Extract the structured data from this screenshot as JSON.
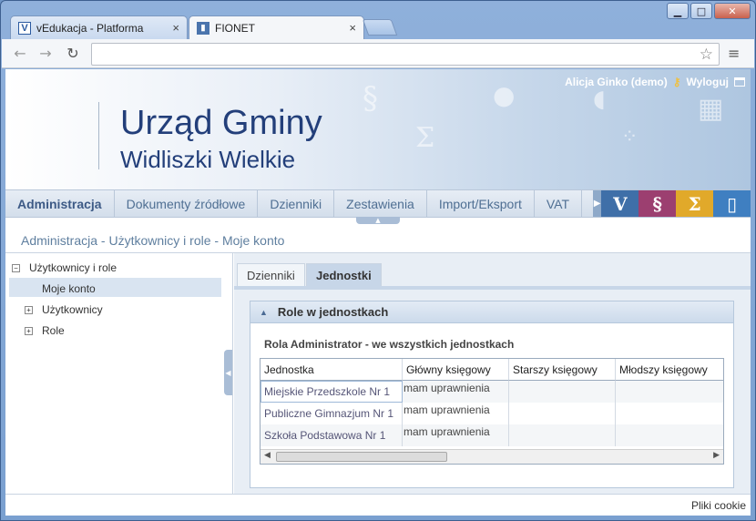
{
  "browser": {
    "tabs": [
      {
        "title": "vEdukacja - Platforma",
        "icon": "v-logo-icon"
      },
      {
        "title": "FIONET",
        "icon": "fionet-logo-icon"
      }
    ],
    "close_glyph": "×",
    "window_controls": {
      "minimize": "▁",
      "maximize": "□",
      "close": "✕"
    },
    "address": ""
  },
  "banner": {
    "title_line1": "Urząd Gminy",
    "title_line2": "Widliszki Wielkie",
    "user": "Alicja Ginko (demo)",
    "logout": "Wyloguj"
  },
  "nav": {
    "items": [
      "Administracja",
      "Dokumenty źródłowe",
      "Dzienniki",
      "Zestawienia",
      "Import/Eksport",
      "VAT"
    ],
    "active": "Administracja",
    "modules": [
      {
        "glyph": "V",
        "color": "#3f6fa8"
      },
      {
        "glyph": "§",
        "color": "#9c3f70"
      },
      {
        "glyph": "Σ",
        "color": "#e1a92a"
      },
      {
        "glyph": "▯",
        "color": "#3f7fc1"
      }
    ]
  },
  "breadcrumb": "Administracja - Użytkownicy i role - Moje konto",
  "tree": {
    "root": {
      "label": "Użytkownicy i role",
      "expander": "−"
    },
    "children": [
      {
        "label": "Moje konto",
        "selected": true
      },
      {
        "label": "Użytkownicy",
        "expander": "+"
      },
      {
        "label": "Role",
        "expander": "+"
      }
    ]
  },
  "panel": {
    "tabs": [
      "Dzienniki",
      "Jednostki"
    ],
    "active_tab": "Jednostki",
    "section_title": "Role w jednostkach",
    "subtitle": "Rola Administrator - we wszystkich jednostkach",
    "table": {
      "columns": [
        "Jednostka",
        "Główny księgowy",
        "Starszy księgowy",
        "Młodszy księgowy"
      ],
      "rows": [
        [
          "Miejskie Przedszkole Nr 1",
          "mam uprawnienia",
          "",
          ""
        ],
        [
          "Publiczne Gimnazjum Nr 1",
          "mam uprawnienia",
          "",
          ""
        ],
        [
          "Szkoła Podstawowa Nr 1",
          "mam uprawnienia",
          "",
          ""
        ]
      ]
    }
  },
  "footer": {
    "cookies": "Pliki cookie"
  }
}
